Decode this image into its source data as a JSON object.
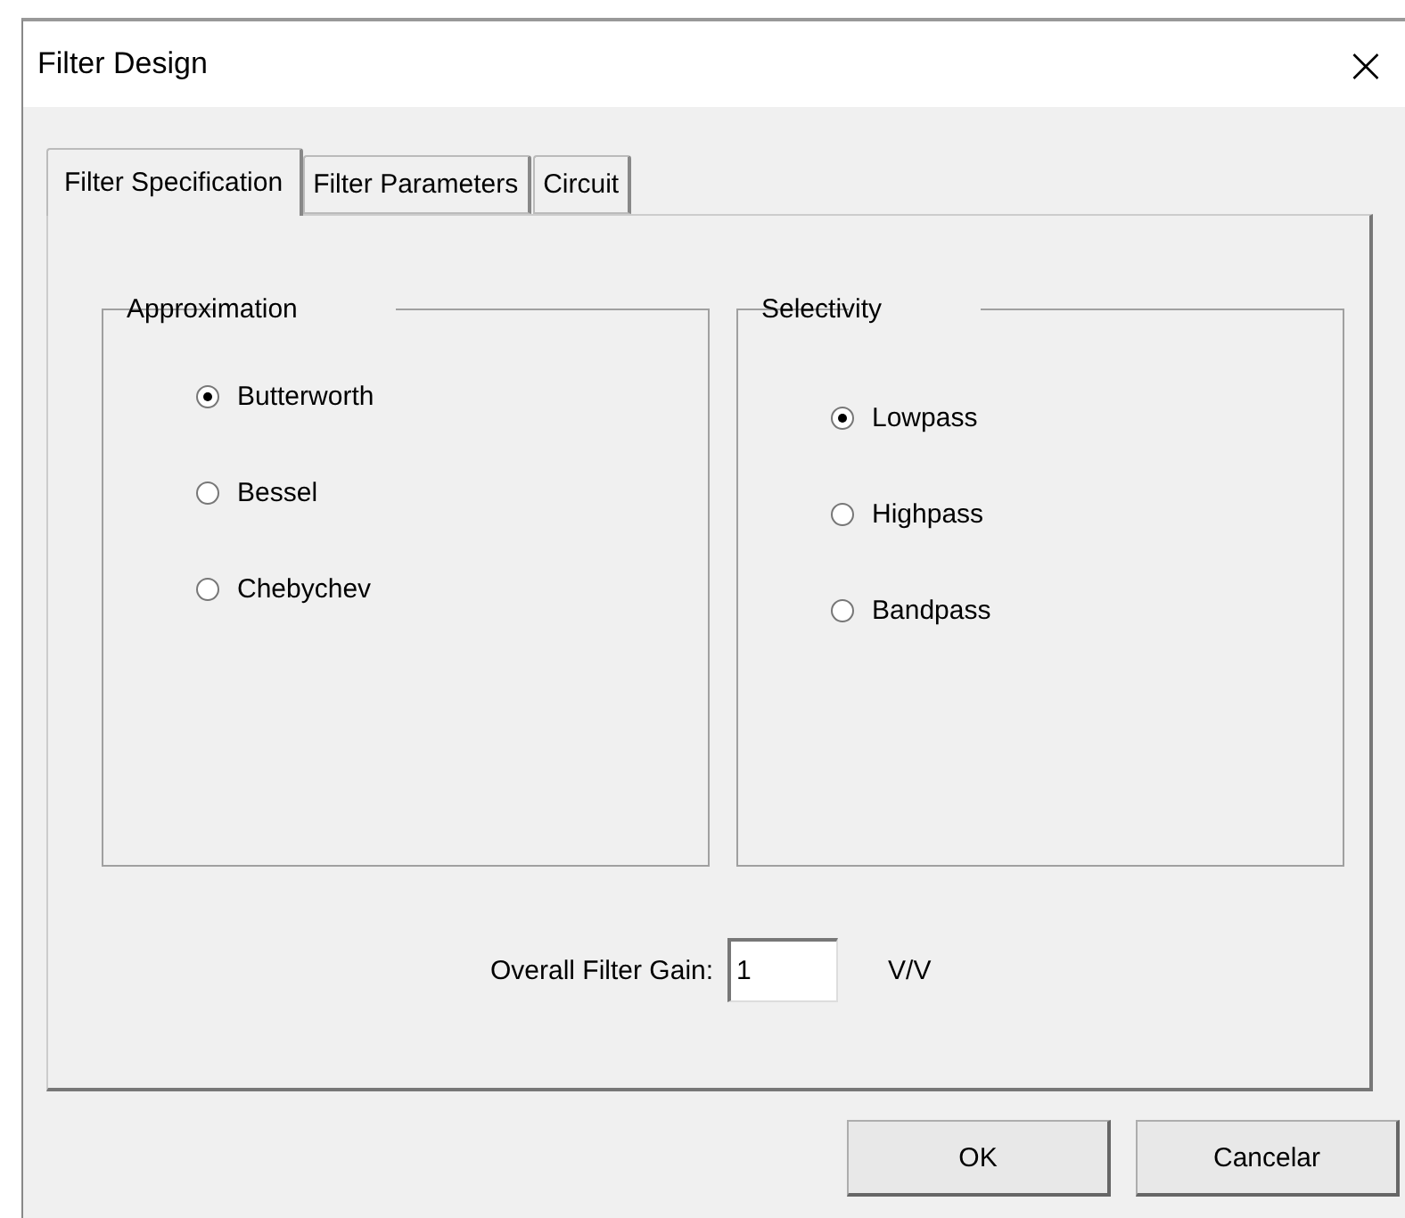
{
  "window": {
    "title": "Filter Design",
    "close": "×"
  },
  "tabs": [
    {
      "label": "Filter Specification",
      "selected": true
    },
    {
      "label": "Filter Parameters",
      "selected": false
    },
    {
      "label": "Circuit",
      "selected": false
    }
  ],
  "groups": [
    {
      "title": "Approximation",
      "options": [
        {
          "label": "Butterworth",
          "selected": true
        },
        {
          "label": "Bessel",
          "selected": false
        },
        {
          "label": "Chebychev",
          "selected": false
        }
      ]
    },
    {
      "title": "Selectivity",
      "options": [
        {
          "label": "Lowpass",
          "selected": true
        },
        {
          "label": "Highpass",
          "selected": false
        },
        {
          "label": "Bandpass",
          "selected": false
        }
      ]
    }
  ],
  "gain": {
    "label": "Overall Filter Gain:",
    "value": "1",
    "unit": "V/V"
  },
  "buttons": [
    "OK",
    "Cancelar"
  ]
}
